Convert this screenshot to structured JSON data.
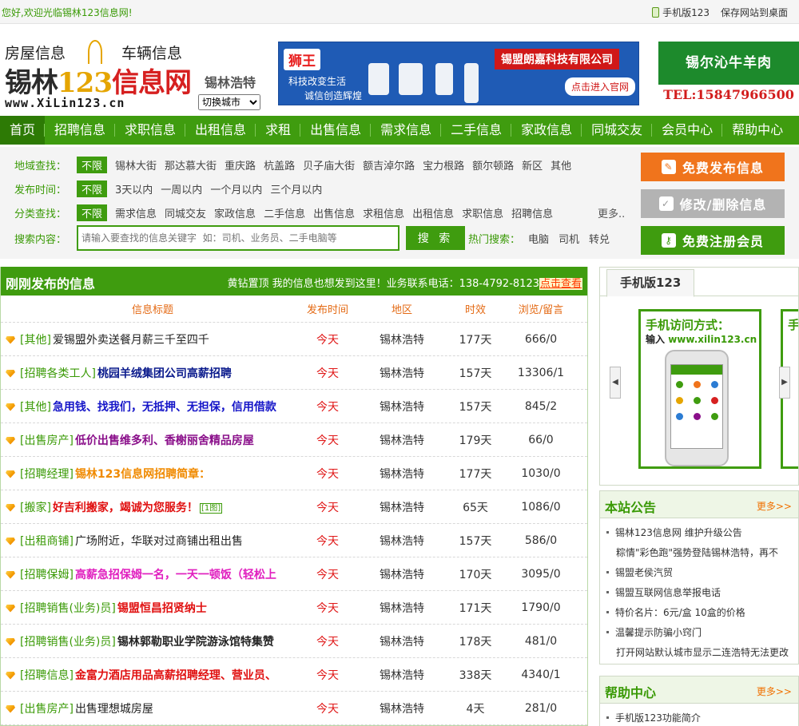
{
  "topbar": {
    "welcome": "您好,欢迎光临锡林123信息网!",
    "mobile_link": "手机版123",
    "save_desktop": "保存网站到桌面"
  },
  "logo": {
    "left_tag": "房屋信息",
    "right_tag": "车辆信息",
    "name_a": "锡林",
    "name_num": "123",
    "name_b": "信息网",
    "url": "www.XiLin123.cn"
  },
  "city": {
    "name": "锡林浩特",
    "switch_label": "切换城市"
  },
  "banner1": {
    "brand": "狮王",
    "slogan1": "科技改变生活",
    "slogan2": "诚信创造辉煌",
    "company": "锡盟朗嘉科技有限公司",
    "enter": "点击进入官网"
  },
  "banner2": {
    "title": "锡尔沁牛羊肉",
    "tel": "TEL:15847966500"
  },
  "nav": [
    "首页",
    "招聘信息",
    "求职信息",
    "出租信息",
    "求租",
    "出售信息",
    "需求信息",
    "二手信息",
    "家政信息",
    "同城交友",
    "会员中心",
    "帮助中心"
  ],
  "filters": {
    "region": {
      "label": "地域查找：",
      "options": [
        "不限",
        "锡林大街",
        "那达慕大街",
        "重庆路",
        "杭盖路",
        "贝子庙大街",
        "额吉淖尔路",
        "宝力根路",
        "额尔顿路",
        "新区",
        "其他"
      ]
    },
    "time": {
      "label": "发布时间：",
      "options": [
        "不限",
        "3天以内",
        "一周以内",
        "一个月以内",
        "三个月以内"
      ]
    },
    "category": {
      "label": "分类查找：",
      "options": [
        "不限",
        "需求信息",
        "同城交友",
        "家政信息",
        "二手信息",
        "出售信息",
        "求租信息",
        "出租信息",
        "求职信息",
        "招聘信息"
      ],
      "more": "更多.."
    },
    "search": {
      "label": "搜索内容：",
      "placeholder": "请输入要查找的信息关键字  如：司机、业务员、二手电脑等",
      "button": "搜 索",
      "hot_label": "热门搜索：",
      "hot": [
        "电脑",
        "司机",
        "转兑"
      ]
    }
  },
  "actions": {
    "publish": "免费发布信息",
    "edit": "修改/删除信息",
    "register": "免费注册会员"
  },
  "listing": {
    "title": "刚刚发布的信息",
    "ad_text": "黄钻置顶 我的信息也想发到这里！业务联系电话：138-4792-8123",
    "ad_link": "点击查看",
    "headers": [
      "信息标题",
      "发布时间",
      "地区",
      "时效",
      "浏览/留言"
    ],
    "rows": [
      {
        "cat": "[其他]",
        "title": "爱锡盟外卖送餐月薪三千至四千",
        "color": "#222222",
        "bold": false,
        "pic": "",
        "time": "今天",
        "area": "锡林浩特",
        "valid": "177天",
        "views": "666/0"
      },
      {
        "cat": "[招聘各类工人]",
        "title": "桃园羊绒集团公司高薪招聘",
        "color": "#0a1a8c",
        "bold": true,
        "pic": "",
        "time": "今天",
        "area": "锡林浩特",
        "valid": "157天",
        "views": "13306/1"
      },
      {
        "cat": "[其他]",
        "title": "急用钱、找我们，无抵押、无担保，信用借款",
        "color": "#1515c8",
        "bold": true,
        "pic": "",
        "time": "今天",
        "area": "锡林浩特",
        "valid": "157天",
        "views": "845/2"
      },
      {
        "cat": "[出售房产]",
        "title": "低价出售维多利、香榭丽舍精品房屋",
        "color": "#8a0f8a",
        "bold": true,
        "pic": "",
        "time": "今天",
        "area": "锡林浩特",
        "valid": "179天",
        "views": "66/0"
      },
      {
        "cat": "[招聘经理]",
        "title": "锡林123信息网招聘简章：",
        "color": "#f08a00",
        "bold": true,
        "pic": "",
        "time": "今天",
        "area": "锡林浩特",
        "valid": "177天",
        "views": "1030/0"
      },
      {
        "cat": "[搬家]",
        "title": "好吉利搬家，竭诚为您服务！",
        "color": "#e01010",
        "bold": true,
        "pic": "[1图]",
        "time": "今天",
        "area": "锡林浩特",
        "valid": "65天",
        "views": "1086/0"
      },
      {
        "cat": "[出租商铺]",
        "title": "广场附近，华联对过商铺出租出售",
        "color": "#222222",
        "bold": false,
        "pic": "",
        "time": "今天",
        "area": "锡林浩特",
        "valid": "157天",
        "views": "586/0"
      },
      {
        "cat": "[招聘保姆]",
        "title": "高薪急招保姆一名，一天一顿饭（轻松上",
        "color": "#e01fbf",
        "bold": true,
        "pic": "",
        "time": "今天",
        "area": "锡林浩特",
        "valid": "170天",
        "views": "3095/0"
      },
      {
        "cat": "[招聘销售(业务)员]",
        "title": "锡盟恒昌招贤纳士",
        "color": "#e01010",
        "bold": true,
        "pic": "",
        "time": "今天",
        "area": "锡林浩特",
        "valid": "171天",
        "views": "1790/0"
      },
      {
        "cat": "[招聘销售(业务)员]",
        "title": "锡林郭勒职业学院游泳馆特集赞",
        "color": "#222222",
        "bold": true,
        "pic": "",
        "time": "今天",
        "area": "锡林浩特",
        "valid": "178天",
        "views": "481/0"
      },
      {
        "cat": "[招聘信息]",
        "title": "金富力酒店用品高薪招聘经理、营业员、",
        "color": "#e01010",
        "bold": true,
        "pic": "",
        "time": "今天",
        "area": "锡林浩特",
        "valid": "338天",
        "views": "4340/1"
      },
      {
        "cat": "[出售房产]",
        "title": "出售理想城房屋",
        "color": "#222222",
        "bold": false,
        "pic": "",
        "time": "今天",
        "area": "锡林浩特",
        "valid": "4天",
        "views": "281/0"
      }
    ]
  },
  "mobile_box": {
    "tab": "手机版123",
    "card_title": "手机访问方式：",
    "card_sub_prefix": "输入",
    "card_sub_url": "www.xilin123.cn",
    "card2_title": "手"
  },
  "notice": {
    "title": "本站公告",
    "more": "更多>>",
    "items": [
      "锡林123信息网 维护升级公告",
      "粽情\"彩色跑\"强势登陆锡林浩特，再不",
      "锡盟老侯汽贸",
      "锡盟互联网信息举报电话",
      "特价名片：6元/盒  10盒的价格",
      "温馨提示防骗小窍门",
      "打开网站默认城市显示二连浩特无法更改"
    ]
  },
  "help": {
    "title": "帮助中心",
    "more": "更多>>",
    "items": [
      "手机版123功能简介"
    ]
  }
}
